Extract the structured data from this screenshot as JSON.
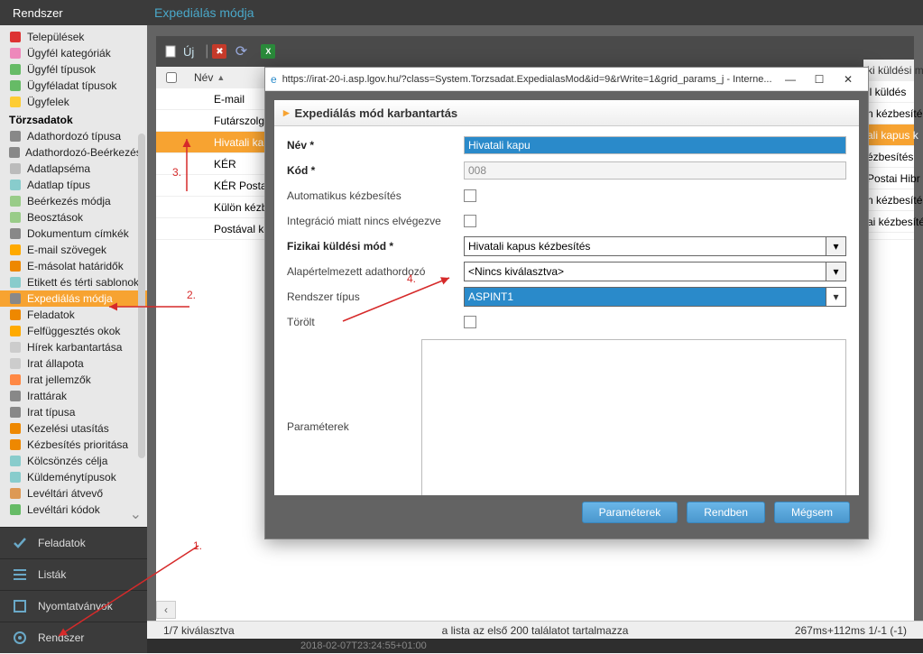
{
  "header": {
    "left": "Rendszer",
    "right": "Expediálás módja"
  },
  "sidebar": {
    "section1": [
      {
        "label": "Települések"
      },
      {
        "label": "Ügyfél kategóriák"
      },
      {
        "label": "Ügyfél típusok"
      },
      {
        "label": "Ügyféladat típusok"
      },
      {
        "label": "Ügyfelek"
      }
    ],
    "section2_title": "Törzsadatok",
    "section2": [
      {
        "label": "Adathordozó típusa"
      },
      {
        "label": "Adathordozó-Beérkezés"
      },
      {
        "label": "Adatlapséma"
      },
      {
        "label": "Adatlap típus"
      },
      {
        "label": "Beérkezés módja"
      },
      {
        "label": "Beosztások"
      },
      {
        "label": "Dokumentum címkék"
      },
      {
        "label": "E-mail szövegek"
      },
      {
        "label": "E-másolat határidők"
      },
      {
        "label": "Etikett és térti sablonok"
      },
      {
        "label": "Expediálás módja",
        "active": true
      },
      {
        "label": "Feladatok"
      },
      {
        "label": "Felfüggesztés okok"
      },
      {
        "label": "Hírek karbantartása"
      },
      {
        "label": "Irat állapota"
      },
      {
        "label": "Irat jellemzők"
      },
      {
        "label": "Irattárak"
      },
      {
        "label": "Irat típusa"
      },
      {
        "label": "Kezelési utasítás"
      },
      {
        "label": "Kézbesítés prioritása"
      },
      {
        "label": "Kölcsönzés célja"
      },
      {
        "label": "Küldeménytípusok"
      },
      {
        "label": "Levéltári átvevő"
      },
      {
        "label": "Levéltári kódok"
      }
    ]
  },
  "bottom_nav": [
    {
      "label": "Feladatok",
      "icon": "check"
    },
    {
      "label": "Listák",
      "icon": "list"
    },
    {
      "label": "Nyomtatványok",
      "icon": "print"
    },
    {
      "label": "Rendszer",
      "icon": "gear"
    }
  ],
  "toolbar": {
    "new_label": "Új",
    "excel_label": "X"
  },
  "grid": {
    "col_name": "Név",
    "col_right": "ki küldési m",
    "rows": [
      {
        "name": "E-mail",
        "right": "il küldés"
      },
      {
        "name": "Futárszolgál.",
        "right": "n kézbesíté"
      },
      {
        "name": "Hivatali kapu",
        "right": "ali kapus k",
        "active": true
      },
      {
        "name": "KÉR",
        "right": "ézbesítés"
      },
      {
        "name": "KÉR Postai H",
        "right": "Postai Hibr"
      },
      {
        "name": "Külön kézbe",
        "right": "n kézbesíté"
      },
      {
        "name": "Postával kéz",
        "right": "ai kézbesíté"
      }
    ],
    "foot_left": "1/7 kiválasztva",
    "foot_center": "a lista az első 200 találatot tartalmazza",
    "foot_right": "267ms+112ms 1/-1 (-1)"
  },
  "footer_date": "2018-02-07T23:24:55+01:00",
  "popup": {
    "url": "https://irat-20-i.asp.lgov.hu/?class=System.Torzsadat.ExpedialasMod&id=9&rWrite=1&grid_params_j - Interne...",
    "title": "Expediálás mód karbantartás",
    "fields": {
      "nev_label": "Név *",
      "nev_value": "Hivatali kapu",
      "kod_label": "Kód *",
      "kod_value": "008",
      "autokezb_label": "Automatikus kézbesítés",
      "integracio_label": "Integráció miatt nincs elvégezve",
      "fizikai_label": "Fizikai küldési mód *",
      "fizikai_value": "Hivatali kapus kézbesítés",
      "alap_label": "Alapértelmezett adathordozó",
      "alap_value": "<Nincs kiválasztva>",
      "rendszer_label": "Rendszer típus",
      "rendszer_value": "ASPINT1",
      "torolt_label": "Törölt",
      "param_label": "Paraméterek"
    },
    "buttons": {
      "param": "Paraméterek",
      "ok": "Rendben",
      "cancel": "Mégsem"
    }
  },
  "annotations": {
    "a1": "1.",
    "a2": "2.",
    "a3": "3.",
    "a4": "4."
  }
}
